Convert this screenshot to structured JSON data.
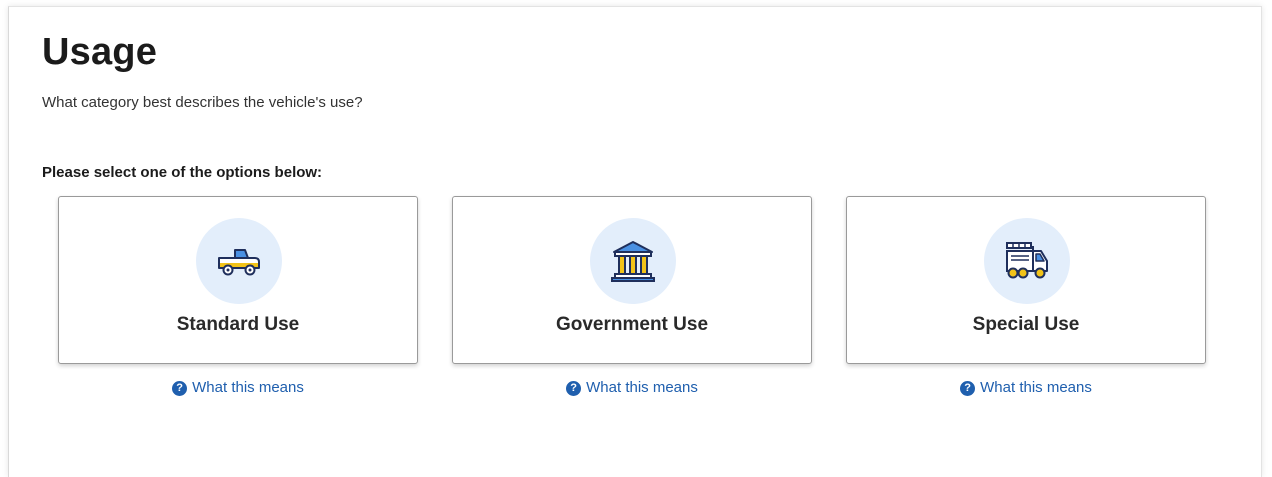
{
  "page": {
    "title": "Usage",
    "subtitle": "What category best describes the vehicle's use?",
    "prompt": "Please select one of the options below:"
  },
  "options": [
    {
      "label": "Standard Use",
      "icon": "pickup-truck-icon",
      "help_text": "What this means"
    },
    {
      "label": "Government Use",
      "icon": "government-building-icon",
      "help_text": "What this means"
    },
    {
      "label": "Special Use",
      "icon": "fire-truck-icon",
      "help_text": "What this means"
    }
  ],
  "colors": {
    "link": "#1f5fae",
    "icon_circle": "#e3eefb",
    "icon_navy": "#1f2f5c",
    "icon_blue": "#4a90e2",
    "icon_yellow": "#f2c318"
  }
}
